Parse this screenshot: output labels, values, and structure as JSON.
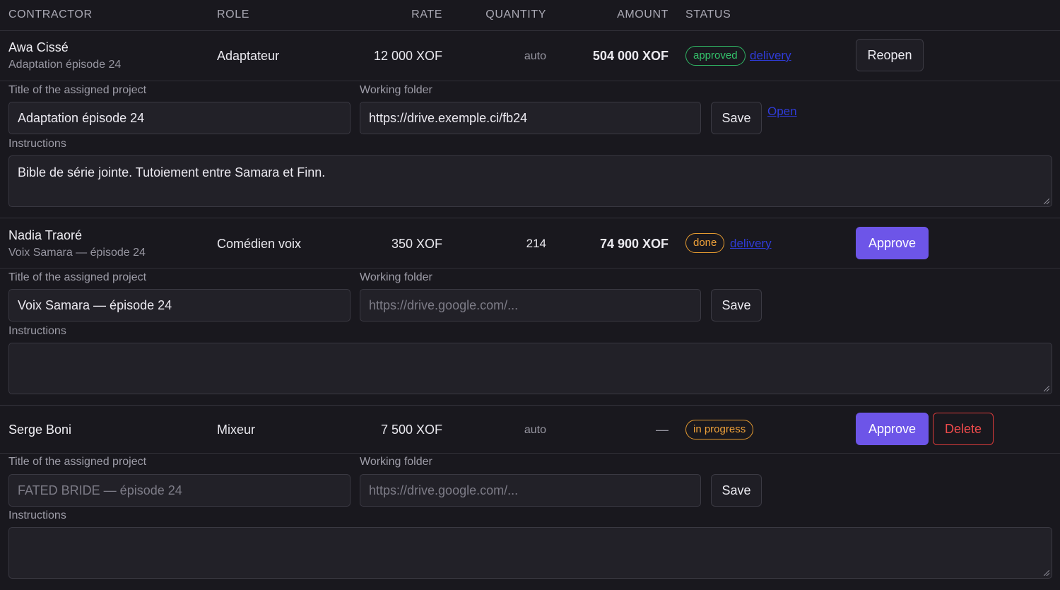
{
  "header": {
    "contractor": "CONTRACTOR",
    "role": "ROLE",
    "rate": "RATE",
    "quantity": "QUANTITY",
    "amount": "AMOUNT",
    "status": "STATUS"
  },
  "labels": {
    "project_title": "Title of the assigned project",
    "working_folder": "Working folder",
    "instructions": "Instructions",
    "save": "Save",
    "open": "Open",
    "delivery": "delivery"
  },
  "entries": [
    {
      "name": "Awa Cissé",
      "subtitle": "Adaptation épisode 24",
      "role": "Adaptateur",
      "rate": "12 000 XOF",
      "quantity": "auto",
      "amount": "504 000 XOF",
      "status": "approved",
      "status_color": "#34c26b",
      "action": "Reopen",
      "project_title_value": "Adaptation épisode 24",
      "folder_value": "https://drive.exemple.ci/fb24",
      "instructions_value": "Bible de série jointe. Tutoiement entre Samara et Finn."
    },
    {
      "name": "Nadia Traoré",
      "subtitle": "Voix Samara — épisode 24",
      "role": "Comédien voix",
      "rate": "350 XOF",
      "quantity": "214",
      "amount": "74 900 XOF",
      "status": "done",
      "status_color": "#f0a23a",
      "action": "Approve",
      "project_title_value": "Voix Samara — épisode 24",
      "folder_placeholder": "https://drive.google.com/...",
      "instructions_value": ""
    },
    {
      "name": "Serge Boni",
      "role": "Mixeur",
      "rate": "7 500 XOF",
      "quantity": "auto",
      "amount": "—",
      "status": "in progress",
      "status_color": "#f0a23a",
      "action": "Approve",
      "delete": "Delete",
      "project_title_placeholder": "FATED BRIDE — épisode 24",
      "folder_placeholder": "https://drive.google.com/...",
      "instructions_value": ""
    }
  ]
}
